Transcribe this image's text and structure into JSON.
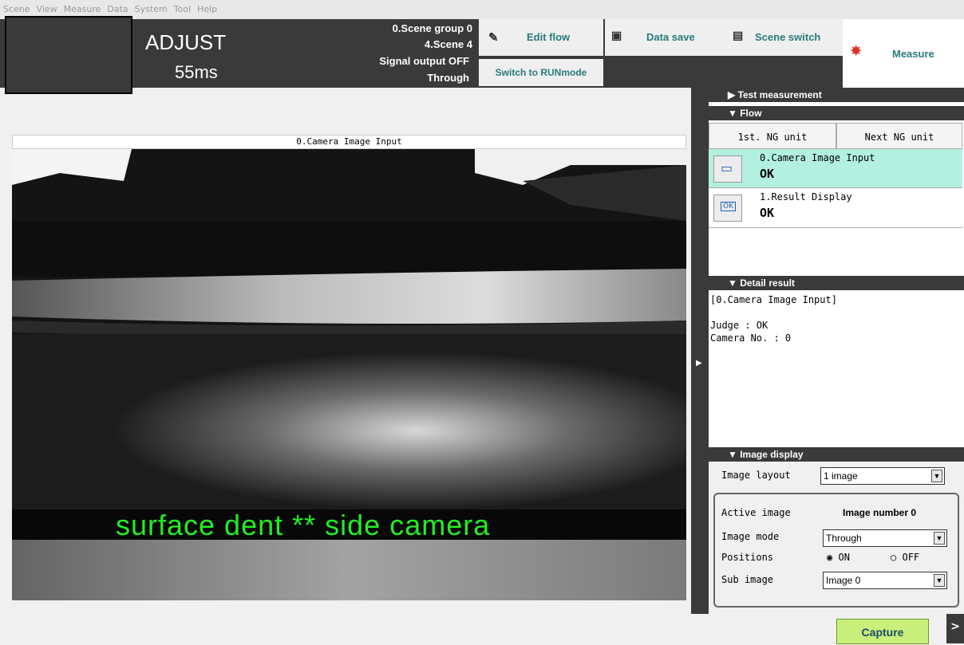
{
  "menu": [
    "Scene",
    "View",
    "Measure",
    "Data",
    "System",
    "Tool",
    "Help"
  ],
  "header": {
    "mode": "ADJUST",
    "time": "55ms",
    "scene_group": "0.Scene group 0",
    "scene": "4.Scene 4",
    "signal_output": "Signal output OFF",
    "through": "Through",
    "edit_flow": "Edit flow",
    "switch_run": "Switch to RUNmode",
    "data_save": "Data save",
    "scene_switch": "Scene switch",
    "measure": "Measure"
  },
  "image_pane": {
    "title": "0.Camera Image Input",
    "caption": "surface dent ** side camera"
  },
  "panel": {
    "test_measurement": "▶ Test measurement",
    "flow": "▼ Flow",
    "first_ng": "1st. NG unit",
    "next_ng": "Next NG unit",
    "units": [
      {
        "name": "0.Camera Image Input",
        "status": "OK"
      },
      {
        "name": "1.Result Display",
        "status": "OK"
      }
    ],
    "detail_result": "▼ Detail result",
    "detail_lines": [
      "[0.Camera Image Input]",
      "",
      "Judge : OK",
      "Camera No. : 0"
    ],
    "image_display": "▼ Image display",
    "image_layout_label": "Image layout",
    "image_layout_value": "1 image",
    "active_image_label": "Active image",
    "active_image_value": "Image number 0",
    "image_mode_label": "Image mode",
    "image_mode_value": "Through",
    "positions_label": "Positions",
    "pos_on": "ON",
    "pos_off": "OFF",
    "sub_image_label": "Sub image",
    "sub_image_value": "Image 0"
  },
  "bottom": {
    "capture": "Capture",
    "expand": ">"
  },
  "colors": {
    "dark": "#3a3a3a",
    "accent": "#2a7a7a",
    "selected_unit": "#b2f0e0",
    "caption": "#22ee22",
    "capture": "#c8f07a"
  }
}
